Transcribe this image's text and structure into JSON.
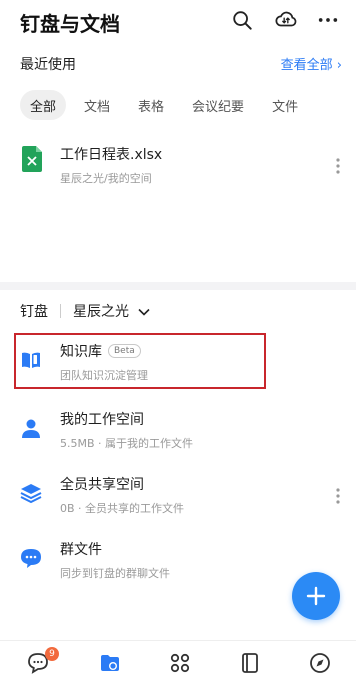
{
  "header": {
    "title": "钉盘与文档",
    "icons": [
      "search-icon",
      "cloud-transfer-icon",
      "more-icon"
    ]
  },
  "recent": {
    "title": "最近使用",
    "see_all": "查看全部 ›",
    "filters": [
      "全部",
      "文档",
      "表格",
      "会议纪要",
      "文件"
    ],
    "active_filter": "全部",
    "files": [
      {
        "name": "工作日程表.xlsx",
        "meta": "星辰之光/我的空间",
        "icon": "xlsx-icon"
      }
    ]
  },
  "drive": {
    "label": "钉盘",
    "space": "星辰之光",
    "items": [
      {
        "title": "知识库",
        "badge": "Beta",
        "sub": "团队知识沉淀管理",
        "icon": "book-icon"
      },
      {
        "title": "我的工作空间",
        "sub": "5.5MB · 属于我的工作文件",
        "icon": "person-icon"
      },
      {
        "title": "全员共享空间",
        "sub": "0B · 全员共享的工作文件",
        "icon": "layers-icon"
      },
      {
        "title": "群文件",
        "sub": "同步到钉盘的群聊文件",
        "icon": "chat-bubble-icon"
      }
    ]
  },
  "tabbar": {
    "message_badge": "9",
    "tabs": [
      "message-icon",
      "drive-icon",
      "apps-icon",
      "contacts-icon",
      "discover-icon"
    ]
  },
  "colors": {
    "accent": "#2b7bf5",
    "highlight": "#c8262c",
    "badge": "#f26a3d"
  }
}
